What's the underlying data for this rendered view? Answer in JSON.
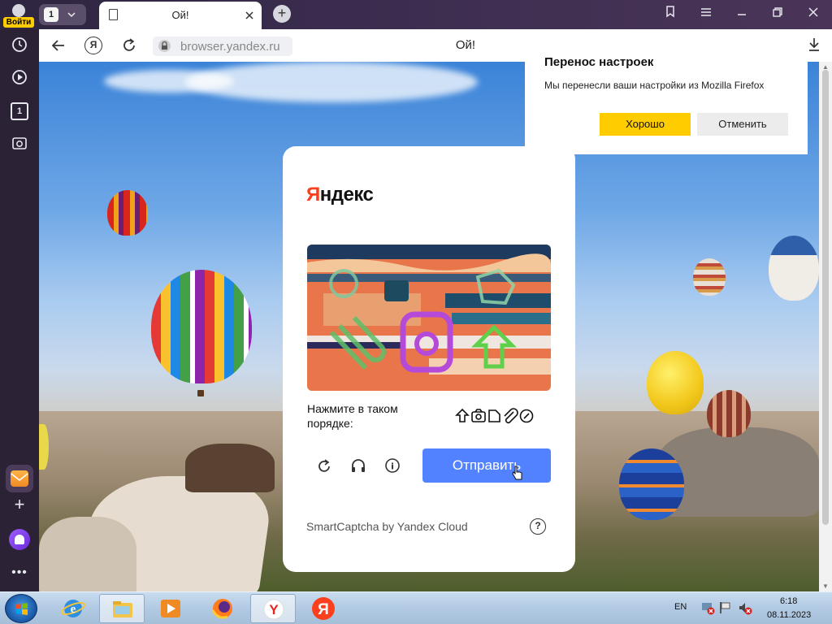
{
  "browser": {
    "profile_label": "Войти",
    "tab_count": "1",
    "tab": {
      "title": "Ой!"
    },
    "url": "browser.yandex.ru",
    "page_title": "Ой!",
    "ya_button": "Я"
  },
  "sidebar": {
    "tab_count_icon": "1"
  },
  "notification": {
    "title": "Перенос настроек",
    "text": "Мы перенесли ваши настройки из Mozilla Firefox",
    "ok_label": "Хорошо",
    "cancel_label": "Отменить"
  },
  "captcha": {
    "logo_ya": "Я",
    "logo_rest": "ндекс",
    "instruction": "Нажмите в таком порядке:",
    "sequence_icons": [
      "arrow-up-icon",
      "camera-icon",
      "document-icon",
      "paperclip-icon",
      "compass-icon"
    ],
    "submit_label": "Отправить",
    "brand": "SmartCaptcha by Yandex Cloud",
    "help_glyph": "?",
    "info_glyph": "i"
  },
  "taskbar": {
    "apps": [
      "internet-explorer",
      "file-explorer",
      "media-player",
      "firefox",
      "yandex-browser",
      "yandex"
    ],
    "language": "EN",
    "time": "6:18",
    "date": "08.11.2023"
  },
  "colors": {
    "yandex_red": "#fc3f1d",
    "accent_yellow": "#ffcc00",
    "submit_blue": "#5282ff"
  }
}
